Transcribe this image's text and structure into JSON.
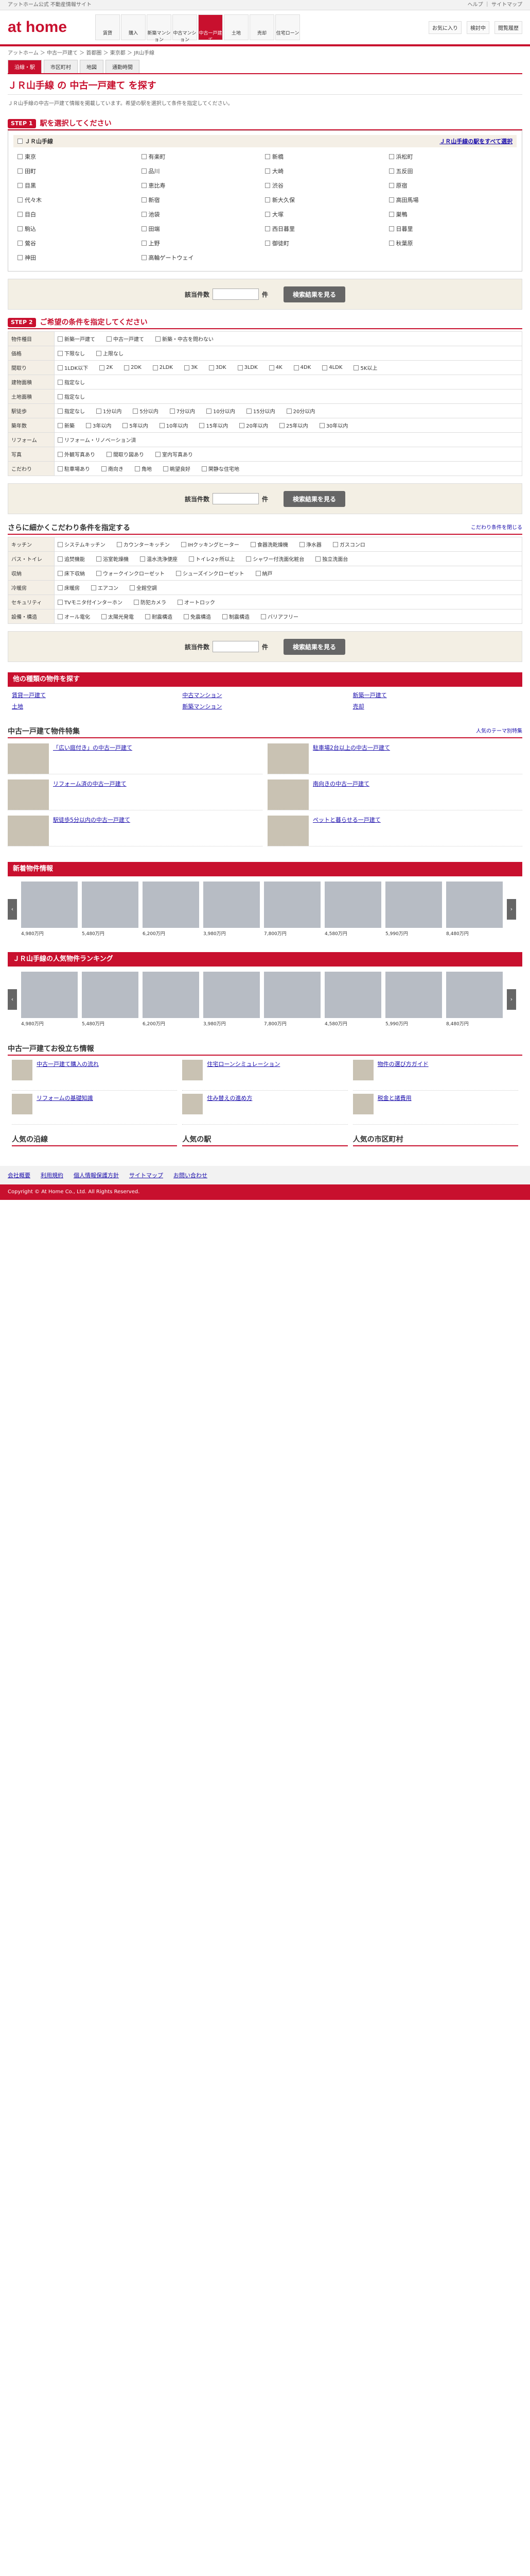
{
  "topbar": {
    "left": "アットホーム公式 不動産情報サイト",
    "right": "ヘルプ ｜ サイトマップ"
  },
  "header": {
    "logo": "at home",
    "nav": [
      "賃貸",
      "購入",
      "新築マンション",
      "中古マンション",
      "中古一戸建て",
      "土地",
      "売却",
      "住宅ローン"
    ],
    "right": [
      "お気に入り",
      "検討中",
      "閲覧履歴"
    ]
  },
  "crumb": "アットホーム ＞ 中古一戸建て ＞ 首都圏 ＞ 東京都 ＞ JR山手線",
  "tabs": [
    "沿線・駅",
    "市区町村",
    "地図",
    "通勤時間"
  ],
  "title": "ＪＲ山手線 の 中古一戸建て を探す",
  "lead": "ＪＲ山手線の中古一戸建て情報を掲載しています。希望の駅を選択して条件を指定してください。",
  "step1": {
    "num": "STEP 1",
    "label": "駅を選択してください"
  },
  "line": {
    "name": "ＪＲ山手線",
    "link": "ＪＲ山手線の駅をすべて選択"
  },
  "stations": [
    "東京",
    "有楽町",
    "新橋",
    "浜松町",
    "田町",
    "品川",
    "大崎",
    "五反田",
    "目黒",
    "恵比寿",
    "渋谷",
    "原宿",
    "代々木",
    "新宿",
    "新大久保",
    "高田馬場",
    "目白",
    "池袋",
    "大塚",
    "巣鴨",
    "駒込",
    "田端",
    "西日暮里",
    "日暮里",
    "鶯谷",
    "上野",
    "御徒町",
    "秋葉原",
    "神田",
    "高輪ゲートウェイ"
  ],
  "countbar": {
    "label": "該当件数",
    "value": "",
    "unit": "件",
    "btn": "検索結果を見る"
  },
  "step2": {
    "num": "STEP 2",
    "label": "ご希望の条件を指定してください"
  },
  "conds": [
    {
      "th": "物件種目",
      "opts": [
        "新築一戸建て",
        "中古一戸建て",
        "新築・中古を問わない"
      ]
    },
    {
      "th": "価格",
      "opts": [
        "下限なし",
        "上限なし"
      ]
    },
    {
      "th": "間取り",
      "opts": [
        "1LDK以下",
        "2K",
        "2DK",
        "2LDK",
        "3K",
        "3DK",
        "3LDK",
        "4K",
        "4DK",
        "4LDK",
        "5K以上"
      ]
    },
    {
      "th": "建物面積",
      "opts": [
        "指定なし"
      ]
    },
    {
      "th": "土地面積",
      "opts": [
        "指定なし"
      ]
    },
    {
      "th": "駅徒歩",
      "opts": [
        "指定なし",
        "1分以内",
        "5分以内",
        "7分以内",
        "10分以内",
        "15分以内",
        "20分以内"
      ]
    },
    {
      "th": "築年数",
      "opts": [
        "新築",
        "3年以内",
        "5年以内",
        "10年以内",
        "15年以内",
        "20年以内",
        "25年以内",
        "30年以内"
      ]
    },
    {
      "th": "リフォーム",
      "opts": [
        "リフォーム・リノベーション済"
      ]
    },
    {
      "th": "写真",
      "opts": [
        "外観写真あり",
        "間取り図あり",
        "室内写真あり"
      ]
    },
    {
      "th": "こだわり",
      "opts": [
        "駐車場あり",
        "南向き",
        "角地",
        "眺望良好",
        "閑静な住宅地"
      ]
    }
  ],
  "detail": {
    "title": "さらに細かくこだわり条件を指定する",
    "link": "こだわり条件を閉じる"
  },
  "features": [
    {
      "th": "キッチン",
      "opts": [
        "システムキッチン",
        "カウンターキッチン",
        "IHクッキングヒーター",
        "食器洗乾燥機",
        "浄水器",
        "ガスコンロ"
      ]
    },
    {
      "th": "バス・トイレ",
      "opts": [
        "追焚機能",
        "浴室乾燥機",
        "温水洗浄便座",
        "トイレ2ヶ所以上",
        "シャワー付洗面化粧台",
        "独立洗面台"
      ]
    },
    {
      "th": "収納",
      "opts": [
        "床下収納",
        "ウォークインクローゼット",
        "シューズインクローゼット",
        "納戸"
      ]
    },
    {
      "th": "冷暖房",
      "opts": [
        "床暖房",
        "エアコン",
        "全館空調"
      ]
    },
    {
      "th": "セキュリティ",
      "opts": [
        "TVモニタ付インターホン",
        "防犯カメラ",
        "オートロック"
      ]
    },
    {
      "th": "設備・構造",
      "opts": [
        "オール電化",
        "太陽光発電",
        "耐震構造",
        "免震構造",
        "制震構造",
        "バリアフリー"
      ]
    }
  ],
  "related": {
    "title": "他の種類の物件を探す",
    "items": [
      "賃貸一戸建て",
      "中古マンション",
      "新築一戸建て",
      "土地",
      "新築マンション",
      "売却"
    ]
  },
  "special": {
    "title": "中古一戸建て物件特集",
    "sub": "人気のテーマ別特集",
    "items": [
      "「広い庭付き」の中古一戸建て",
      "駐車場2台以上の中古一戸建て",
      "リフォーム済の中古一戸建て",
      "南向きの中古一戸建て",
      "駅徒歩5分以内の中古一戸建て",
      "ペットと暮らせる一戸建て"
    ]
  },
  "newest": {
    "title": "新着物件情報",
    "price": [
      "4,980万円",
      "5,480万円",
      "6,200万円",
      "3,980万円",
      "7,800万円",
      "4,580万円",
      "5,990万円",
      "8,480万円"
    ]
  },
  "ranking": {
    "title": "ＪＲ山手線の人気物件ランキング"
  },
  "help": {
    "title": "中古一戸建てお役立ち情報",
    "items": [
      "中古一戸建て購入の流れ",
      "住宅ローンシミュレーション",
      "物件の選び方ガイド",
      "リフォームの基礎知識",
      "住み替えの進め方",
      "税金と諸費用"
    ]
  },
  "popular": {
    "heads": [
      "人気の沿線",
      "人気の駅",
      "人気の市区町村"
    ]
  },
  "footer": {
    "links": [
      "会社概要",
      "利用規約",
      "個人情報保護方針",
      "サイトマップ",
      "お問い合わせ"
    ],
    "copy": "Copyright © At Home Co., Ltd. All Rights Reserved."
  }
}
